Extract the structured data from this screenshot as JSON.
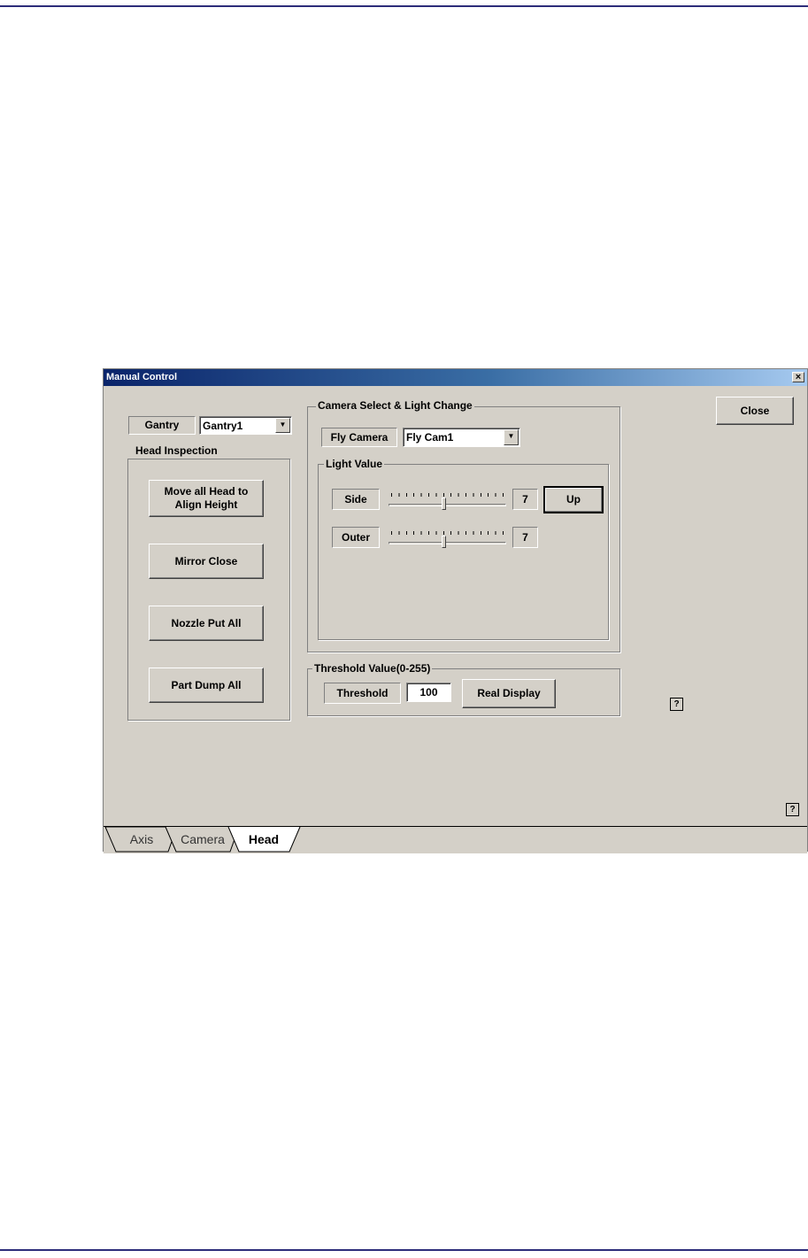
{
  "window": {
    "title": "Manual Control"
  },
  "gantry": {
    "label": "Gantry",
    "selected": "Gantry1"
  },
  "head_inspection": {
    "title": "Head Inspection",
    "buttons": [
      {
        "line1": "Move all Head to",
        "line2": "Align Height"
      },
      {
        "line1": "Mirror Close",
        "line2": ""
      },
      {
        "line1": "Nozzle Put All",
        "line2": ""
      },
      {
        "line1": "Part Dump All",
        "line2": ""
      }
    ]
  },
  "camera_select": {
    "title": "Camera Select & Light Change",
    "camera_label": "Fly Camera",
    "camera_selected": "Fly Cam1",
    "light_value": {
      "title": "Light Value",
      "side_label": "Side",
      "side_value": "7",
      "side_level": 7,
      "outer_label": "Outer",
      "outer_value": "7",
      "outer_level": 7,
      "max_level": 15,
      "up_button": "Up"
    }
  },
  "threshold": {
    "title": "Threshold Value(0-255)",
    "label": "Threshold",
    "value": "100",
    "real_display_button": "Real Display"
  },
  "close_button": "Close",
  "help_glyph": "?",
  "tabs": [
    {
      "label": "Axis",
      "active": false
    },
    {
      "label": "Camera",
      "active": false
    },
    {
      "label": "Head",
      "active": true
    }
  ]
}
